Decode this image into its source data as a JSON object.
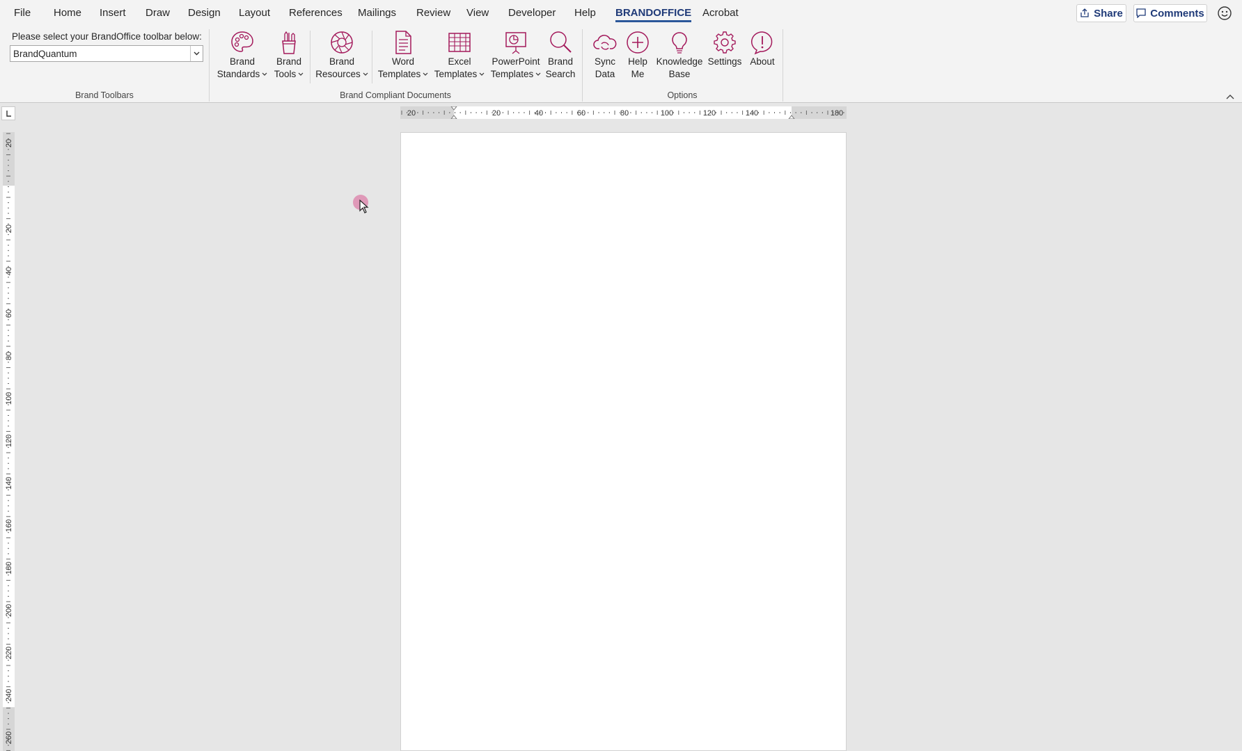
{
  "menu": {
    "tabs": [
      {
        "label": "File"
      },
      {
        "label": "Home"
      },
      {
        "label": "Insert"
      },
      {
        "label": "Draw"
      },
      {
        "label": "Design"
      },
      {
        "label": "Layout"
      },
      {
        "label": "References"
      },
      {
        "label": "Mailings"
      },
      {
        "label": "Review"
      },
      {
        "label": "View"
      },
      {
        "label": "Developer"
      },
      {
        "label": "Help"
      },
      {
        "label": "BRANDOFFICE"
      },
      {
        "label": "Acrobat"
      }
    ],
    "active_tab": "BRANDOFFICE",
    "share_label": "Share",
    "comments_label": "Comments",
    "icons": {
      "share": "share-icon",
      "comments": "comment-icon",
      "feedback": "smiley-icon"
    }
  },
  "ribbon": {
    "toolbar_prompt": "Please select your BrandOffice toolbar below:",
    "toolbar_value": "BrandQuantum",
    "groups": {
      "brand_toolbars": "Brand Toolbars",
      "compliant_docs": "Brand Compliant Documents",
      "options": "Options"
    },
    "buttons": {
      "brand_standards": {
        "line1": "Brand",
        "line2": "Standards",
        "icon": "palette-icon"
      },
      "brand_tools": {
        "line1": "Brand",
        "line2": "Tools",
        "icon": "pencil-cup-icon"
      },
      "brand_resources": {
        "line1": "Brand",
        "line2": "Resources",
        "icon": "aperture-icon"
      },
      "word_templates": {
        "line1": "Word",
        "line2": "Templates",
        "icon": "word-document-icon"
      },
      "excel_templates": {
        "line1": "Excel",
        "line2": "Templates",
        "icon": "spreadsheet-icon"
      },
      "powerpoint_templates": {
        "line1": "PowerPoint",
        "line2": "Templates",
        "icon": "presentation-icon"
      },
      "brand_search": {
        "line1": "Brand",
        "line2": "Search",
        "icon": "search-icon"
      },
      "sync_data": {
        "line1": "Sync",
        "line2": "Data",
        "icon": "cloud-sync-icon"
      },
      "help_me": {
        "line1": "Help",
        "line2": "Me",
        "icon": "plus-circle-icon"
      },
      "knowledge_base": {
        "line1": "Knowledge",
        "line2": "Base",
        "icon": "lightbulb-icon"
      },
      "settings": {
        "line1": "Settings",
        "line2": "",
        "icon": "gear-icon"
      },
      "about": {
        "line1": "About",
        "line2": "",
        "icon": "exclamation-bubble-icon"
      }
    }
  },
  "rulers": {
    "horizontal_labels": [
      "20",
      "20",
      "40",
      "60",
      "80",
      "100",
      "120",
      "140",
      "180"
    ],
    "vertical_labels": [
      "20",
      "20",
      "40",
      "60",
      "80",
      "100",
      "120",
      "140",
      "160",
      "180",
      "200",
      "220",
      "240",
      "260"
    ]
  },
  "colors": {
    "accent": "#a3195b",
    "active_tab": "#2b579a",
    "cursor_highlight": "#db70a0"
  }
}
